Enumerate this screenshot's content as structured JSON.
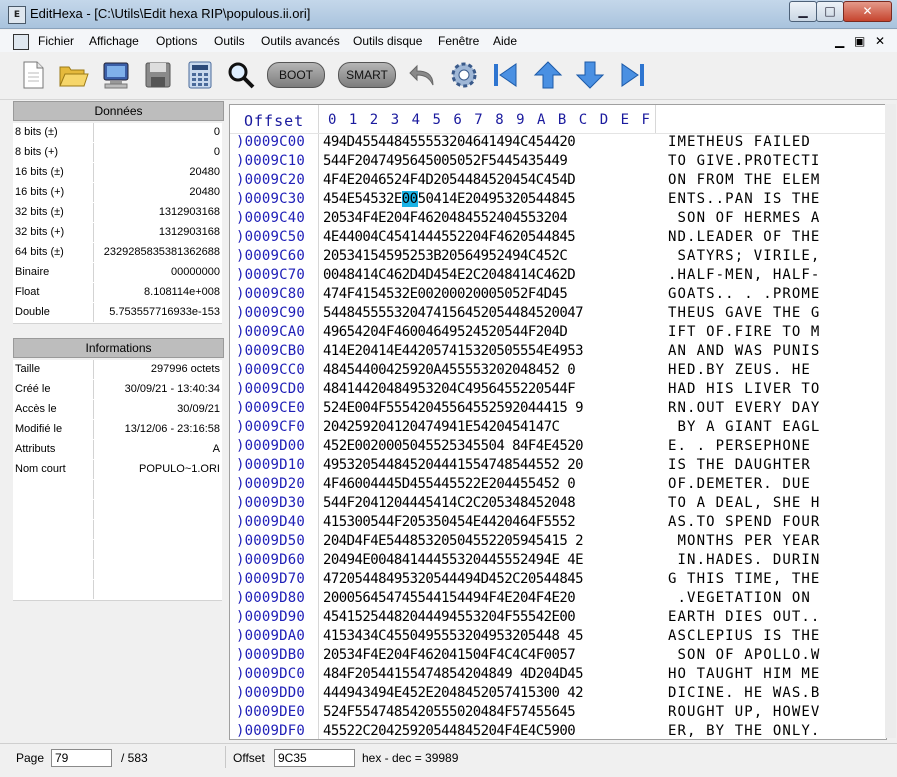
{
  "title": "EditHexa - [C:\\Utils\\Edit hexa RIP\\populous.ii.ori]",
  "window_controls": {
    "minimize": "▁",
    "maximize": "□",
    "close": "✕"
  },
  "menu": [
    "Fichier",
    "Affichage",
    "Options",
    "Outils",
    "Outils avancés",
    "Outils disque",
    "Fenêtre",
    "Aide"
  ],
  "mdi_controls": {
    "minimize": "▁",
    "restore": "▣",
    "close": "✕"
  },
  "toolbar": {
    "boot_label": "BOOT",
    "smart_label": "SMART"
  },
  "donnees": {
    "title": "Données",
    "rows": [
      {
        "label": "8 bits (±)",
        "value": "0"
      },
      {
        "label": "8 bits (+)",
        "value": "0"
      },
      {
        "label": "16 bits (±)",
        "value": "20480"
      },
      {
        "label": "16 bits (+)",
        "value": "20480"
      },
      {
        "label": "32 bits (±)",
        "value": "1312903168"
      },
      {
        "label": "32 bits (+)",
        "value": "1312903168"
      },
      {
        "label": "64 bits (±)",
        "value": "2329285835381362688"
      },
      {
        "label": "Binaire",
        "value": "00000000"
      },
      {
        "label": "Float",
        "value": "8.108114e+008"
      },
      {
        "label": "Double",
        "value": "5.753557716933e-153"
      }
    ]
  },
  "informations": {
    "title": "Informations",
    "rows": [
      {
        "label": "Taille",
        "value": "297996 octets"
      },
      {
        "label": "Créé le",
        "value": "30/09/21 - 13:40:34"
      },
      {
        "label": "Accès le",
        "value": "30/09/21"
      },
      {
        "label": "Modifié le",
        "value": "13/12/06 - 23:16:58"
      },
      {
        "label": "Attributs",
        "value": "A"
      },
      {
        "label": "Nom court",
        "value": "POPULO~1.ORI"
      },
      {
        "label": "",
        "value": ""
      },
      {
        "label": "",
        "value": ""
      },
      {
        "label": "",
        "value": ""
      },
      {
        "label": "",
        "value": ""
      },
      {
        "label": "",
        "value": ""
      },
      {
        "label": "",
        "value": ""
      }
    ]
  },
  "hex": {
    "offset_header": "Offset",
    "columns": [
      "0",
      "1",
      "2",
      "3",
      "4",
      "5",
      "6",
      "7",
      "8",
      "9",
      "A",
      "B",
      "C",
      "D",
      "E",
      "F"
    ],
    "rows": [
      {
        "offset": ")0009C00",
        "hex": "494D455448455553204641494C454420",
        "ascii": "IMETHEUS FAILED "
      },
      {
        "offset": ")0009C10",
        "hex": "544F2047495645005052F5445435449",
        "ascii": "TO GIVE.PROTECTI"
      },
      {
        "offset": ")0009C20",
        "hex": "4F4E2046524F4D2054484520454C454D",
        "ascii": "ON FROM THE ELEM"
      },
      {
        "offset": ")0009C30",
        "hex_pre": "454E54532E",
        "hex_sel": "00",
        "hex_post": "50414E20495320544845",
        "ascii": "ENTS..PAN IS THE"
      },
      {
        "offset": ")0009C40",
        "hex": "20534F4E204F4620484552404553204",
        "ascii": " SON OF HERMES A"
      },
      {
        "offset": ")0009C50",
        "hex": "4E44004C4541444552204F4620544845",
        "ascii": "ND.LEADER OF THE"
      },
      {
        "offset": ")0009C60",
        "hex": "20534154595253B20564952494C452C",
        "ascii": " SATYRS; VIRILE,"
      },
      {
        "offset": ")0009C70",
        "hex": "0048414C462D4D454E2C2048414C462D",
        "ascii": ".HALF-MEN, HALF-"
      },
      {
        "offset": ")0009C80",
        "hex": "474F4154532E00200020005052F4D45",
        "ascii": "GOATS.. . .PROME"
      },
      {
        "offset": ")0009C90",
        "hex": "544845555320474156452054484520047",
        "ascii": "THEUS GAVE THE G"
      },
      {
        "offset": ")0009CA0",
        "hex": "49654204F46004649524520544F204D",
        "ascii": "IFT OF.FIRE TO M"
      },
      {
        "offset": ")0009CB0",
        "hex": "414E20414E442057415320505554E4953",
        "ascii": "AN AND WAS PUNIS"
      },
      {
        "offset": ")0009CC0",
        "hex": "48454400425920A455553202048452 0",
        "ascii": "HED.BY ZEUS. HE "
      },
      {
        "offset": ")0009CD0",
        "hex": "48414420484953204C4956455220544F",
        "ascii": "HAD HIS LIVER TO"
      },
      {
        "offset": ")0009CE0",
        "hex": "524E004F55542045564552592044415 9",
        "ascii": "RN.OUT EVERY DAY"
      },
      {
        "offset": ")0009CF0",
        "hex": "204259204120474941E5420454147C",
        "ascii": " BY A GIANT EAGL"
      },
      {
        "offset": ")0009D00",
        "hex": "452E0020005045525345504 84F4E4520",
        "ascii": "E. . PERSEPHONE "
      },
      {
        "offset": ")0009D10",
        "hex": "495320544845204441554748544552 20",
        "ascii": "IS THE DAUGHTER "
      },
      {
        "offset": ")0009D20",
        "hex": "4F46004445D455445522E204455452 0",
        "ascii": "OF.DEMETER. DUE "
      },
      {
        "offset": ")0009D30",
        "hex": "544F2041204445414C2C205348452048",
        "ascii": "TO A DEAL, SHE H"
      },
      {
        "offset": ")0009D40",
        "hex": "415300544F205350454E4420464F5552",
        "ascii": "AS.TO SPEND FOUR"
      },
      {
        "offset": ")0009D50",
        "hex": "204D4F4E54485320504552205945415 2",
        "ascii": " MONTHS PER YEAR"
      },
      {
        "offset": ")0009D60",
        "hex": "20494E00484144455320445552494E 4E",
        "ascii": " IN.HADES. DURIN"
      },
      {
        "offset": ")0009D70",
        "hex": "47205448495320544494D452C20544845",
        "ascii": "G THIS TIME, THE"
      },
      {
        "offset": ")0009D80",
        "hex": "200056454745544154494F4E204F4E20",
        "ascii": " .VEGETATION ON "
      },
      {
        "offset": ")0009D90",
        "hex": "45415254482044494553204F55542E00",
        "ascii": "EARTH DIES OUT.."
      },
      {
        "offset": ")0009DA0",
        "hex": "4153434C4550495553204953205448 45",
        "ascii": "ASCLEPIUS IS THE"
      },
      {
        "offset": ")0009DB0",
        "hex": "20534F4E204F462041504F4C4C4F0057",
        "ascii": " SON OF APOLLO.W"
      },
      {
        "offset": ")0009DC0",
        "hex": "484F20544155474854204849 4D204D45",
        "ascii": "HO TAUGHT HIM ME"
      },
      {
        "offset": ")0009DD0",
        "hex": "444943494E452E2048452057415300 42",
        "ascii": "DICINE. HE WAS.B"
      },
      {
        "offset": ")0009DE0",
        "hex": "524F5547485420555020484F57455645",
        "ascii": "ROUGHT UP, HOWEV"
      },
      {
        "offset": ")0009DF0",
        "hex": "45522C20425920544845204F4E4C5900",
        "ascii": "ER, BY THE ONLY."
      }
    ]
  },
  "status": {
    "page_label": "Page",
    "page_value": "79",
    "page_total": "/ 583",
    "offset_label": "Offset",
    "offset_value": "9C35",
    "hexdec": "hex - dec = 39989"
  }
}
